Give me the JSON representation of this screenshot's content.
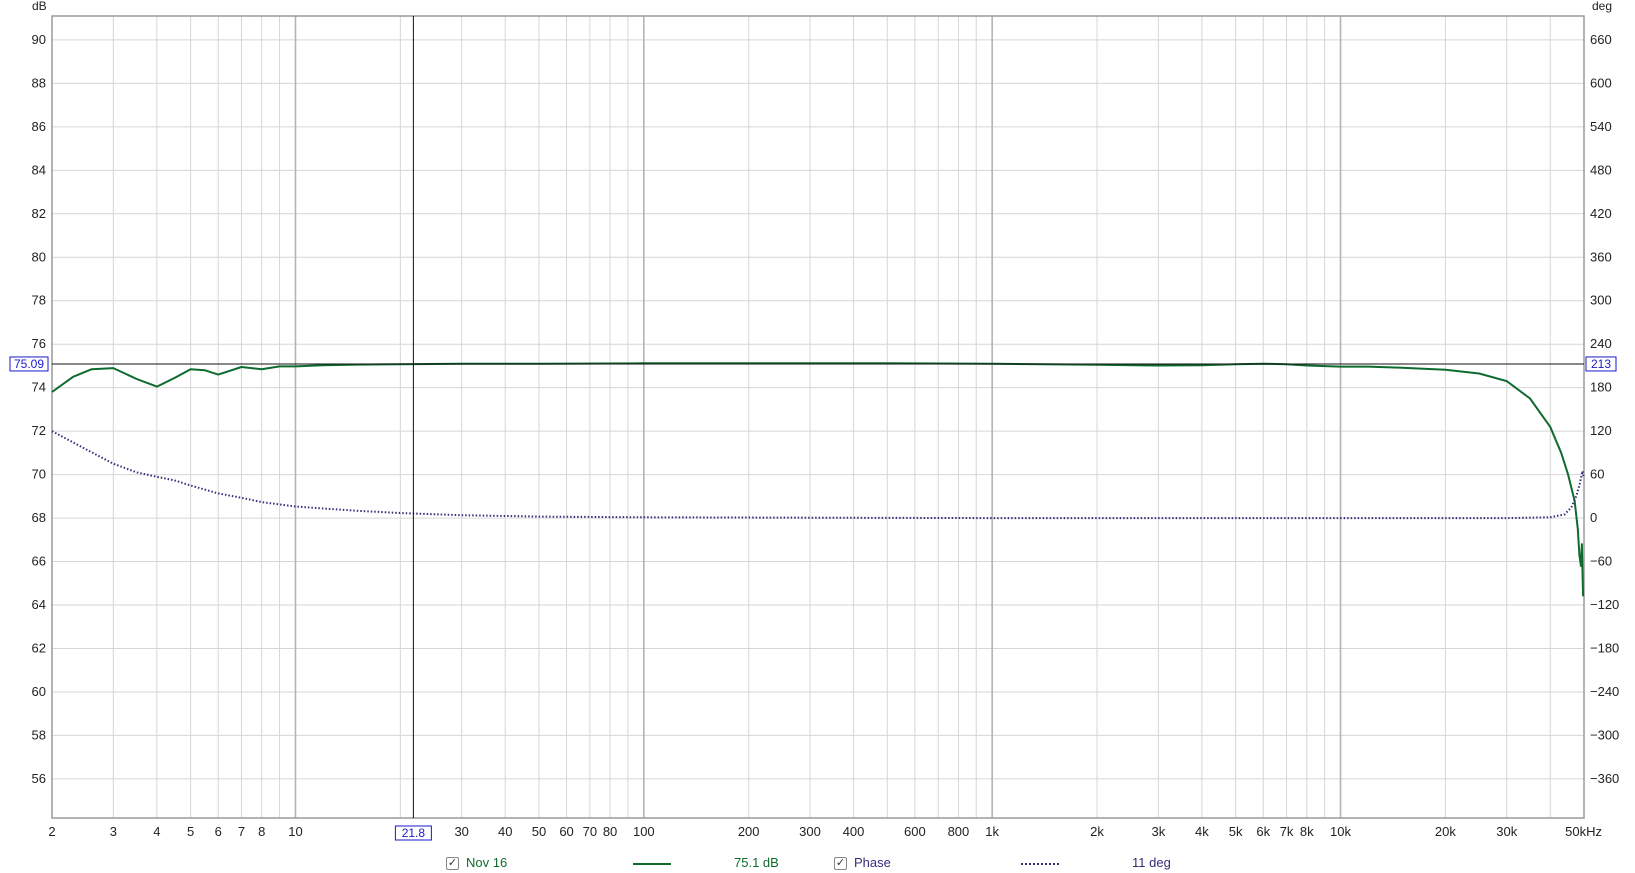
{
  "chart_data": {
    "type": "line",
    "xscale": "log",
    "xlim": [
      2,
      50000
    ],
    "x_ticks": [
      {
        "v": 2,
        "label": "2"
      },
      {
        "v": 3,
        "label": "3"
      },
      {
        "v": 4,
        "label": "4"
      },
      {
        "v": 5,
        "label": "5"
      },
      {
        "v": 6,
        "label": "6"
      },
      {
        "v": 7,
        "label": "7"
      },
      {
        "v": 8,
        "label": "8"
      },
      {
        "v": 10,
        "label": "10"
      },
      {
        "v": 30,
        "label": "30"
      },
      {
        "v": 40,
        "label": "40"
      },
      {
        "v": 50,
        "label": "50"
      },
      {
        "v": 60,
        "label": "60"
      },
      {
        "v": 70,
        "label": "70"
      },
      {
        "v": 80,
        "label": "80"
      },
      {
        "v": 100,
        "label": "100"
      },
      {
        "v": 200,
        "label": "200"
      },
      {
        "v": 300,
        "label": "300"
      },
      {
        "v": 400,
        "label": "400"
      },
      {
        "v": 600,
        "label": "600"
      },
      {
        "v": 800,
        "label": "800"
      },
      {
        "v": 1000,
        "label": "1k"
      },
      {
        "v": 2000,
        "label": "2k"
      },
      {
        "v": 3000,
        "label": "3k"
      },
      {
        "v": 4000,
        "label": "4k"
      },
      {
        "v": 5000,
        "label": "5k"
      },
      {
        "v": 6000,
        "label": "6k"
      },
      {
        "v": 7000,
        "label": "7k"
      },
      {
        "v": 8000,
        "label": "8k"
      },
      {
        "v": 10000,
        "label": "10k"
      },
      {
        "v": 20000,
        "label": "20k"
      },
      {
        "v": 30000,
        "label": "30k"
      },
      {
        "v": 50000,
        "label": "50kHz"
      }
    ],
    "ylim": [
      54.2,
      91.1
    ],
    "ylabel": "dB",
    "y_ticks": [
      56,
      58,
      60,
      62,
      64,
      66,
      68,
      70,
      72,
      74,
      76,
      78,
      80,
      82,
      84,
      86,
      88,
      90
    ],
    "y2lim": [
      -414,
      693
    ],
    "y2label": "deg",
    "y2_ticks": [
      {
        "v": -360,
        "label": "−360"
      },
      {
        "v": -300,
        "label": "−300"
      },
      {
        "v": -240,
        "label": "−240"
      },
      {
        "v": -180,
        "label": "−180"
      },
      {
        "v": -120,
        "label": "−120"
      },
      {
        "v": -60,
        "label": "−60"
      },
      {
        "v": 0,
        "label": "0"
      },
      {
        "v": 60,
        "label": "60"
      },
      {
        "v": 120,
        "label": "120"
      },
      {
        "v": 180,
        "label": "180"
      },
      {
        "v": 240,
        "label": "240"
      },
      {
        "v": 300,
        "label": "300"
      },
      {
        "v": 360,
        "label": "360"
      },
      {
        "v": 420,
        "label": "420"
      },
      {
        "v": 480,
        "label": "480"
      },
      {
        "v": 540,
        "label": "540"
      },
      {
        "v": 600,
        "label": "600"
      },
      {
        "v": 660,
        "label": "660"
      }
    ],
    "grid": true,
    "cursor": {
      "x": 21.8,
      "x_label": "21.8",
      "y": 75.09,
      "y_label": "75.09",
      "y2_label": "213"
    },
    "series": [
      {
        "name": "Nov 16",
        "axis": "left",
        "style": "solid",
        "color": "#0e6b2e",
        "readout": "75.1 dB",
        "x": [
          2,
          2.3,
          2.6,
          3,
          3.5,
          4,
          4.5,
          5,
          5.5,
          6,
          7,
          8,
          9,
          10,
          12,
          15,
          20,
          30,
          50,
          100,
          200,
          500,
          1000,
          2000,
          3000,
          4000,
          5000,
          6000,
          7000,
          8000,
          10000,
          12000,
          15000,
          20000,
          25000,
          30000,
          35000,
          40000,
          43000,
          45000,
          47000,
          48000,
          48500,
          49000,
          49300,
          49500,
          49700
        ],
        "y": [
          73.8,
          74.5,
          74.85,
          74.9,
          74.4,
          74.05,
          74.45,
          74.85,
          74.8,
          74.6,
          74.95,
          74.85,
          74.98,
          74.98,
          75.03,
          75.06,
          75.08,
          75.1,
          75.1,
          75.12,
          75.12,
          75.12,
          75.1,
          75.05,
          75.02,
          75.03,
          75.08,
          75.1,
          75.08,
          75.02,
          74.97,
          74.97,
          74.92,
          74.82,
          74.65,
          74.3,
          73.5,
          72.2,
          71.0,
          70.0,
          68.8,
          67.5,
          66.3,
          65.8,
          66.8,
          65.5,
          64.4
        ]
      },
      {
        "name": "Phase",
        "axis": "right",
        "style": "dotted",
        "color": "#3a2a7a",
        "readout": "11 deg",
        "x": [
          2,
          2.5,
          3,
          3.5,
          4,
          4.5,
          5,
          6,
          7,
          8,
          10,
          15,
          20,
          30,
          50,
          100,
          300,
          1000,
          10000,
          30000,
          40000,
          44000,
          46000,
          47500,
          48500,
          49000,
          49500,
          49800
        ],
        "y": [
          120,
          95,
          75,
          63,
          57,
          52,
          45,
          34,
          28,
          22,
          16,
          10,
          7,
          4,
          2,
          1,
          0.5,
          0,
          0,
          0,
          1,
          5,
          15,
          30,
          45,
          55,
          65,
          58
        ]
      }
    ],
    "legend": {
      "position": "bottom"
    }
  }
}
